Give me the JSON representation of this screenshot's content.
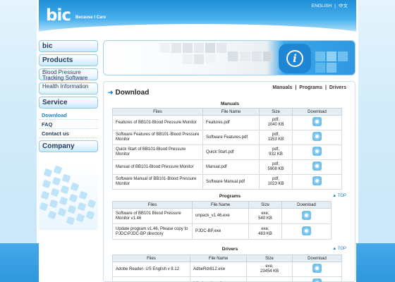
{
  "header": {
    "logo": "bic",
    "tagline": "Because I Care",
    "lang_english": "ENGLISH",
    "lang_divider": "|",
    "lang_chinese": "中文"
  },
  "nav": {
    "bic": "bic",
    "products": "Products",
    "bp_software": "Blood Pressure Tracking Software",
    "health_info": "Health Information",
    "service": "Service",
    "download": "Download",
    "faq": "FAQ",
    "contact": "Contact us",
    "company": "Company"
  },
  "breadcrumb": {
    "manuals": "Manuals",
    "programs": "Programs",
    "drivers": "Drivers",
    "sep": "|"
  },
  "page_title": "Download",
  "columns": {
    "files": "Files",
    "file_name": "File Name",
    "size": "Size",
    "download": "Download"
  },
  "top_label": "TOP",
  "sections": {
    "manuals": {
      "title": "Manuals",
      "rows": [
        {
          "file": "Features of BB101-Blood Pressure Monitor",
          "name": "Features.pdf",
          "size1": "pdf,",
          "size2": "1040 KB"
        },
        {
          "file": "Software Features of BB101-Blood Pressure Monitor",
          "name": "Software Features.pdf",
          "size1": "pdf,",
          "size2": "1153 KB"
        },
        {
          "file": "Quick Start of BB101-Blood Pressure Monitor",
          "name": "Quick Start.pdf",
          "size1": "pdf,",
          "size2": "932 KB"
        },
        {
          "file": "Manual of BB101-Blood Pressure Monitor",
          "name": "Manual.pdf",
          "size1": "pdf,",
          "size2": "5908 KB"
        },
        {
          "file": "Software Manual of BB101-Blood Pressure Monitor",
          "name": "Software Manual.pdf",
          "size1": "pdf,",
          "size2": "1023 KB"
        }
      ]
    },
    "programs": {
      "title": "Programs",
      "rows": [
        {
          "file": "Software of BB101 Blood Pressure Monitor v1.46",
          "name": "unpack_v1.46.exe",
          "size1": "exe,",
          "size2": "540 KB"
        },
        {
          "file": "Update program v1.46, Please copy to PJDC\\PJDC-BP directory",
          "name": "PJDC-BP.exe",
          "size1": "exe,",
          "size2": "483 KB"
        }
      ]
    },
    "drivers": {
      "title": "Drivers",
      "rows": [
        {
          "file": "Adobe Reader- US English v 8.12",
          "name": "AdbeRdr812.exe",
          "size1": "exe,",
          "size2": "23454 KB"
        },
        {
          "file": "",
          "name": "WindowsInstaller",
          "size1": "exe",
          "size2": ""
        }
      ]
    }
  }
}
